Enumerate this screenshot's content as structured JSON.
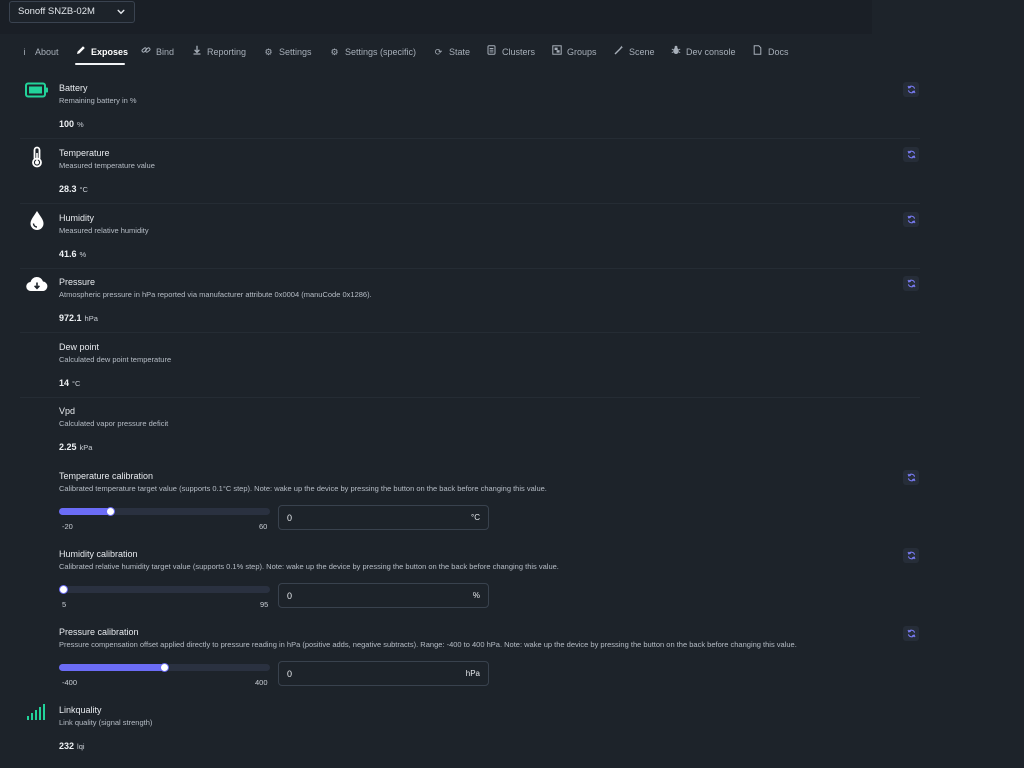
{
  "device": {
    "selected": "Sonoff SNZB-02M"
  },
  "tabs": [
    {
      "label": "About",
      "icon": "info-icon"
    },
    {
      "label": "Exposes",
      "icon": "pencil-icon"
    },
    {
      "label": "Bind",
      "icon": "link-icon"
    },
    {
      "label": "Reporting",
      "icon": "download-icon"
    },
    {
      "label": "Settings",
      "icon": "gears-icon"
    },
    {
      "label": "Settings (specific)",
      "icon": "gear-icon"
    },
    {
      "label": "State",
      "icon": "refresh-icon"
    },
    {
      "label": "Clusters",
      "icon": "list-icon"
    },
    {
      "label": "Groups",
      "icon": "object-group-icon"
    },
    {
      "label": "Scene",
      "icon": "wand-icon"
    },
    {
      "label": "Dev console",
      "icon": "bug-icon"
    },
    {
      "label": "Docs",
      "icon": "document-icon"
    }
  ],
  "active_tab": "Exposes",
  "colors": {
    "accent": "#6b6cf6",
    "battery": "#22d39a",
    "linkquality": "#22d39a"
  },
  "exposes": {
    "battery": {
      "name": "Battery",
      "description": "Remaining battery in %",
      "value": "100",
      "unit": "%",
      "icon": "battery-full-icon"
    },
    "temperature": {
      "name": "Temperature",
      "description": "Measured temperature value",
      "value": "28.3",
      "unit": "°C",
      "icon": "thermometer-icon"
    },
    "humidity": {
      "name": "Humidity",
      "description": "Measured relative humidity",
      "value": "41.6",
      "unit": "%",
      "icon": "droplet-icon"
    },
    "pressure": {
      "name": "Pressure",
      "description": "Atmospheric pressure in hPa reported via manufacturer attribute 0x0004 (manuCode 0x1286).",
      "value": "972.1",
      "unit": "hPa",
      "icon": "cloud-download-icon"
    },
    "dew_point": {
      "name": "Dew point",
      "description": "Calculated dew point temperature",
      "value": "14",
      "unit": "°C"
    },
    "vpd": {
      "name": "Vpd",
      "description": "Calculated vapor pressure deficit",
      "value": "2.25",
      "unit": "kPa"
    },
    "temperature_calibration": {
      "name": "Temperature calibration",
      "description": "Calibrated temperature target value (supports 0.1°C step). Note: wake up the device by pressing the button on the back before changing this value.",
      "min": "-20",
      "max": "60",
      "value": "0",
      "unit": "°C",
      "slider_level": 0.245
    },
    "humidity_calibration": {
      "name": "Humidity calibration",
      "description": "Calibrated relative humidity target value (supports 0.1% step). Note: wake up the device by pressing the button on the back before changing this value.",
      "min": "5",
      "max": "95",
      "value": "0",
      "unit": "%",
      "slider_level": 0.0
    },
    "pressure_calibration": {
      "name": "Pressure calibration",
      "description": "Pressure compensation offset applied directly to pressure reading in hPa (positive adds, negative subtracts). Range: -400 to 400 hPa. Note: wake up the device by pressing the button on the back before changing this value.",
      "min": "-400",
      "max": "400",
      "value": "0",
      "unit": "hPa",
      "slider_level": 0.5
    },
    "linkquality": {
      "name": "Linkquality",
      "description": "Link quality (signal strength)",
      "value": "232",
      "unit": "lqi",
      "icon": "signal-bars-icon"
    }
  }
}
